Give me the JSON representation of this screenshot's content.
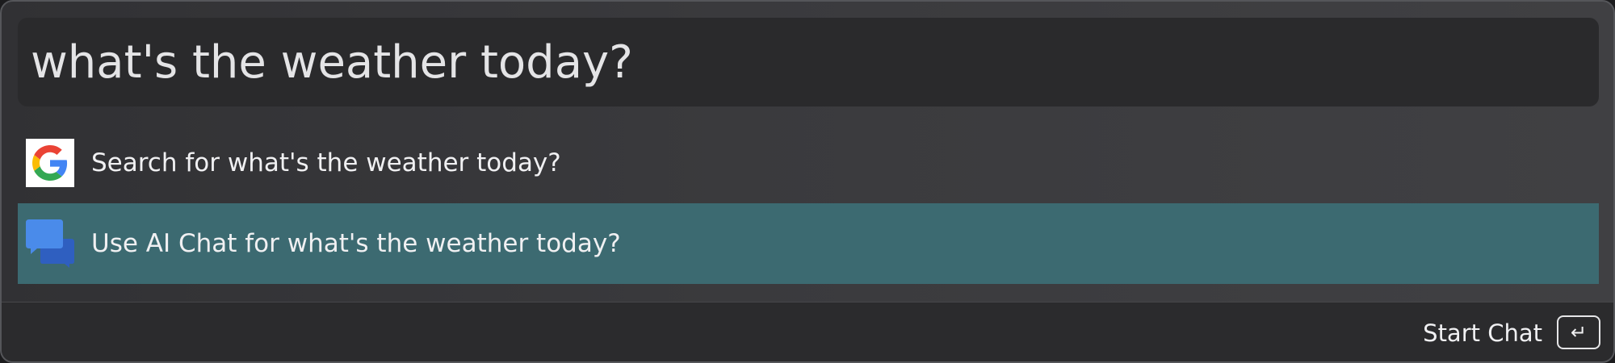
{
  "search": {
    "query": "what's the weather today?"
  },
  "results": [
    {
      "icon": "google-icon",
      "label": "Search for what's the weather today?"
    },
    {
      "icon": "chat-bubbles-icon",
      "label": "Use AI Chat for what's the weather today?",
      "selected": true
    }
  ],
  "footer": {
    "action_label": "Start Chat",
    "action_key_icon": "return-key-icon",
    "action_key_glyph": "↵"
  },
  "colors": {
    "selected_row": "#3c6a71",
    "chat_icon": "#3f7de6",
    "google_blue": "#4285F4",
    "google_red": "#EA4335",
    "google_yellow": "#FBBC05",
    "google_green": "#34A853"
  }
}
